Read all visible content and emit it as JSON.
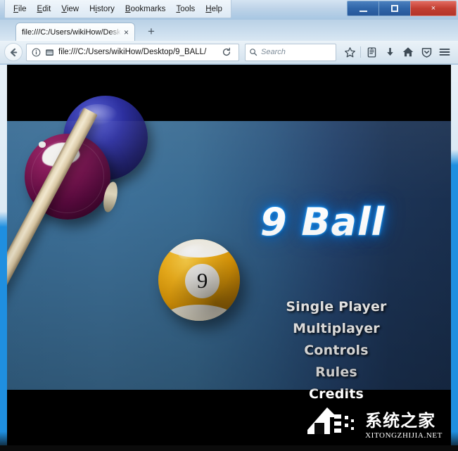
{
  "browser": {
    "menu_items": [
      {
        "label": "File",
        "accel": "F"
      },
      {
        "label": "Edit",
        "accel": "E"
      },
      {
        "label": "View",
        "accel": "V"
      },
      {
        "label": "History",
        "accel": "i"
      },
      {
        "label": "Bookmarks",
        "accel": "B"
      },
      {
        "label": "Tools",
        "accel": "T"
      },
      {
        "label": "Help",
        "accel": "H"
      }
    ],
    "window_controls": {
      "minimize": "minimize-button",
      "maximize": "maximize-button",
      "close": "close-button",
      "close_glyph": "×"
    },
    "tab": {
      "title": "file:///C:/Users/wikiHow/Desktop",
      "close_glyph": "×",
      "new_tab_glyph": "+"
    },
    "toolbar": {
      "back_glyph": "←",
      "url": "file:///C:/Users/wikiHow/Desktop/9_BALL/",
      "reload_glyph": "⟳",
      "search_placeholder": "Search",
      "icons": [
        "bookmark-star-icon",
        "library-icon",
        "downloads-icon",
        "home-icon",
        "pocket-shield-icon",
        "hamburger-menu-icon"
      ]
    }
  },
  "game": {
    "title": "9 Ball",
    "menu": [
      "Single Player",
      "Multiplayer",
      "Controls",
      "Rules",
      "Credits"
    ],
    "ball_number": "9",
    "colors": {
      "felt_left": "#3a6d95",
      "felt_right": "#1a3050",
      "title_glow": "#1f8fe8",
      "ball_nine": "#f6b51c",
      "ball_purple": "#7b1450",
      "ball_blue": "#2c2f9e",
      "cue_wood": "#f2e8cf",
      "letterbox": "#000000"
    }
  },
  "watermark": {
    "chinese": "系统之家",
    "english": "XITONGZHIJIA.NET"
  }
}
